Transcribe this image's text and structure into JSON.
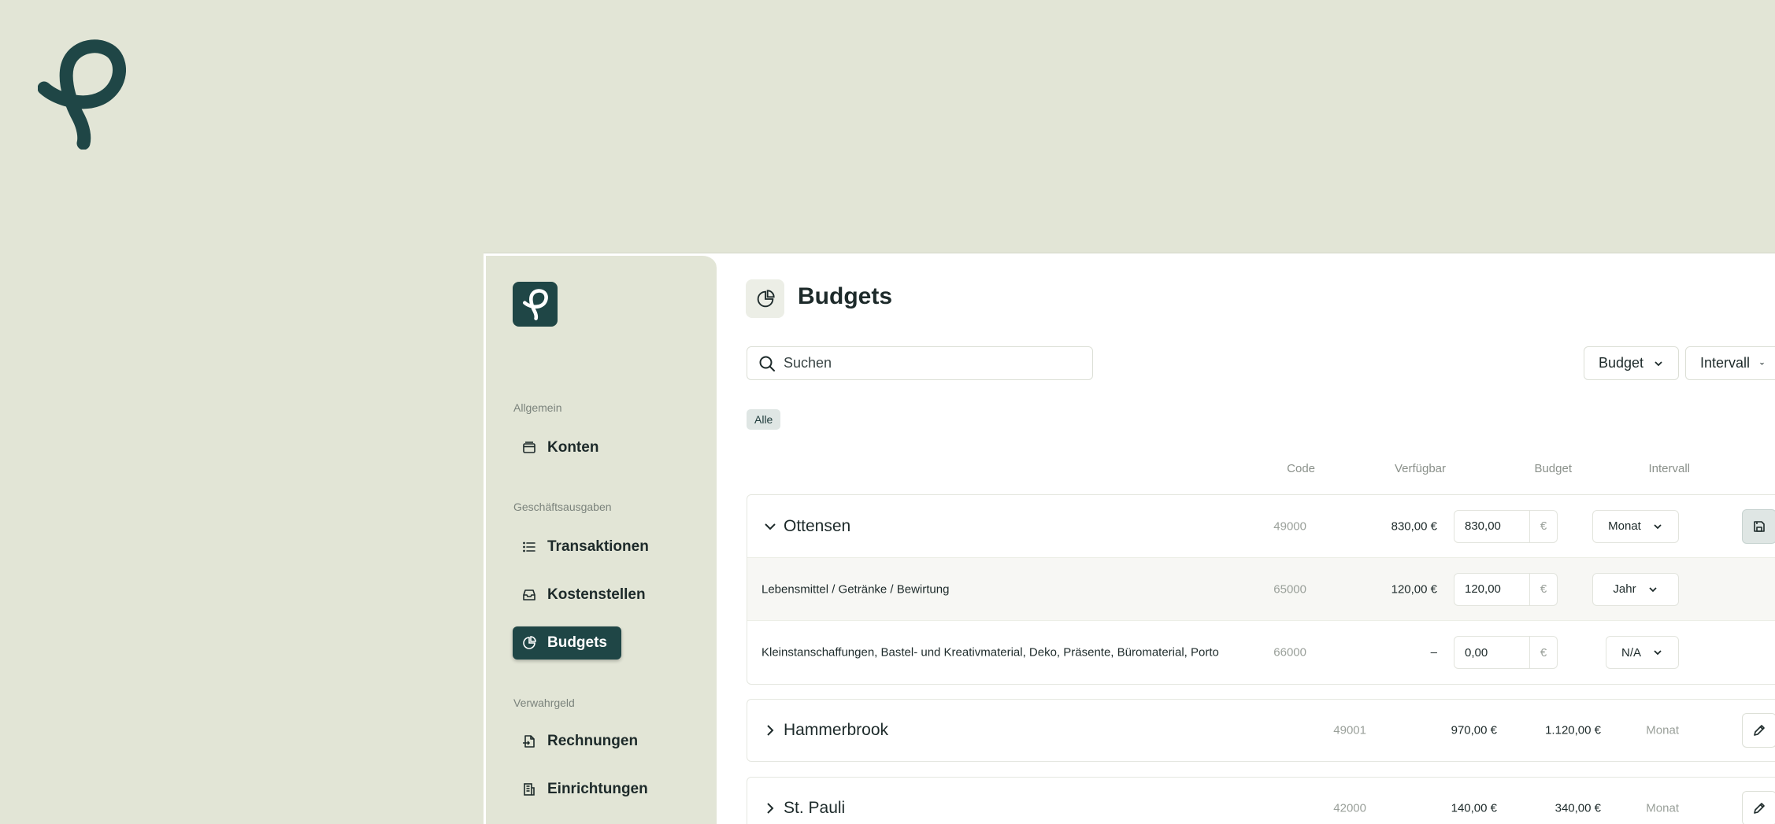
{
  "sidebar": {
    "sections": [
      {
        "label": "Allgemein"
      },
      {
        "label": "Geschäftsausgaben"
      },
      {
        "label": "Verwahrgeld"
      }
    ],
    "items": [
      {
        "label": "Konten",
        "icon": "wallet-icon"
      },
      {
        "label": "Transaktionen",
        "icon": "list-icon"
      },
      {
        "label": "Kostenstellen",
        "icon": "inbox-icon"
      },
      {
        "label": "Budgets",
        "icon": "pie-chart-icon",
        "active": true
      },
      {
        "label": "Rechnungen",
        "icon": "file-import-icon"
      },
      {
        "label": "Einrichtungen",
        "icon": "building-icon"
      }
    ]
  },
  "page": {
    "title": "Budgets",
    "icon": "pie-chart-icon"
  },
  "search": {
    "placeholder": "Suchen"
  },
  "filters": {
    "budget_label": "Budget",
    "interval_label": "Intervall"
  },
  "chip": {
    "label": "Alle"
  },
  "columns": {
    "code": "Code",
    "available": "Verfügbar",
    "budget": "Budget",
    "interval": "Intervall"
  },
  "groups": [
    {
      "name": "Ottensen",
      "code": "49000",
      "available": "830,00 €",
      "budget": "830,00",
      "currency": "€",
      "interval": "Monat",
      "expanded": true,
      "children": [
        {
          "name": "Lebensmittel / Getränke / Bewirtung",
          "code": "65000",
          "available": "120,00 €",
          "budget": "120,00",
          "currency": "€",
          "interval": "Jahr"
        },
        {
          "name": "Kleinstanschaffungen, Bastel- und Kreativmaterial, Deko, Präsente, Büromaterial, Porto",
          "code": "66000",
          "available": "–",
          "budget": "0,00",
          "currency": "€",
          "interval": "N/A"
        }
      ]
    },
    {
      "name": "Hammerbrook",
      "code": "49001",
      "available": "970,00 €",
      "budget": "1.120,00 €",
      "interval": "Monat",
      "expanded": false
    },
    {
      "name": "St. Pauli",
      "code": "42000",
      "available": "140,00 €",
      "budget": "340,00 €",
      "interval": "Monat",
      "expanded": false
    }
  ],
  "colors": {
    "background": "#e2e5d6",
    "brand": "#1f4646",
    "surface": "#ffffff"
  }
}
